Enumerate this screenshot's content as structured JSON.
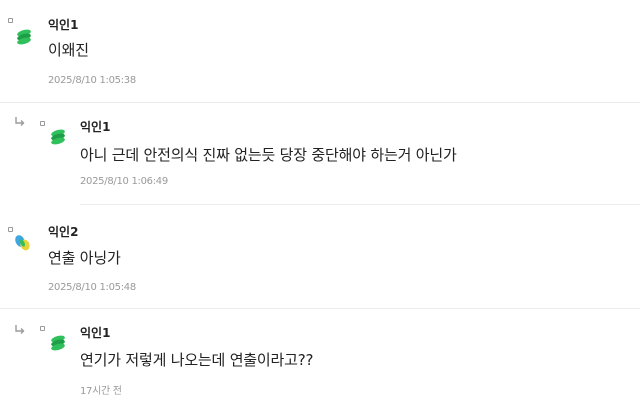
{
  "comments": [
    {
      "author": "익인1",
      "text": "이왜진",
      "time": "2025/8/10 1:05:38",
      "avatar": "green-stack-avatar-icon",
      "is_reply": false
    },
    {
      "author": "익인1",
      "text": "아니 근데 안전의식 진짜 없는듯 당장 중단해야 하는거 아닌가",
      "time": "2025/8/10 1:06:49",
      "avatar": "green-stack-avatar-icon",
      "is_reply": true
    },
    {
      "author": "익인2",
      "text": "연출 아닝가",
      "time": "2025/8/10 1:05:48",
      "avatar": "blue-yellow-avatar-icon",
      "is_reply": false
    },
    {
      "author": "익인1",
      "text": "연기가 저렇게 나오는데 연출이라고??",
      "time": "17시간 전",
      "avatar": "green-stack-avatar-icon",
      "is_reply": true
    }
  ],
  "colors": {
    "green": "#2fbf5b",
    "green_dark": "#1e9e46",
    "blue": "#3fa6e0",
    "yellow": "#e6d43a",
    "meta_text": "#9a9a9a",
    "divider": "#ececec"
  }
}
